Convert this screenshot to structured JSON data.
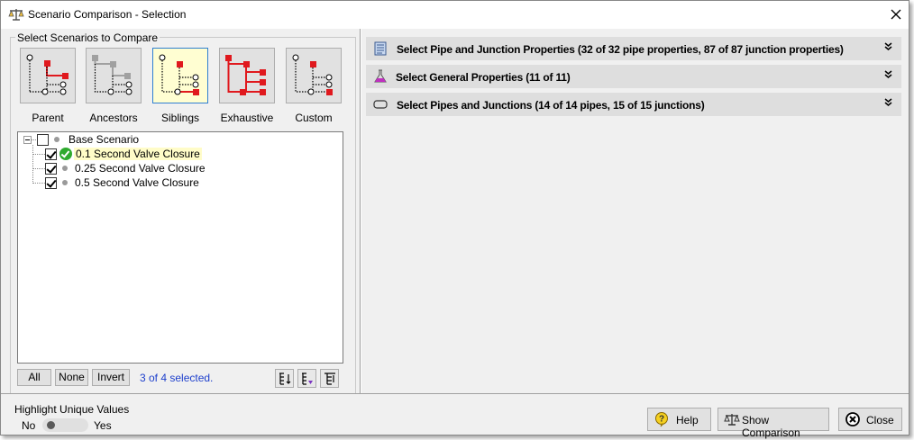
{
  "window": {
    "title": "Scenario Comparison - Selection"
  },
  "left_pane": {
    "group_label": "Select Scenarios to Compare",
    "scenario_buttons": [
      {
        "label": "Parent",
        "selected": false
      },
      {
        "label": "Ancestors",
        "selected": false
      },
      {
        "label": "Siblings",
        "selected": true
      },
      {
        "label": "Exhaustive",
        "selected": false
      },
      {
        "label": "Custom",
        "selected": false
      }
    ],
    "tree": [
      {
        "label": "Base Scenario",
        "checked": false,
        "level": 0,
        "marker": "gray-dot"
      },
      {
        "label": "0.1 Second Valve Closure",
        "checked": true,
        "level": 1,
        "marker": "green-check",
        "highlighted": true
      },
      {
        "label": "0.25 Second Valve Closure",
        "checked": true,
        "level": 1,
        "marker": "gray-dot"
      },
      {
        "label": "0.5 Second Valve Closure",
        "checked": true,
        "level": 1,
        "marker": "gray-dot"
      }
    ],
    "buttons": {
      "all": "All",
      "none": "None",
      "invert": "Invert"
    },
    "selected_count": "3 of 4 selected."
  },
  "right_pane": {
    "sections": [
      {
        "label": "Select Pipe and Junction Properties (32 of 32  pipe properties, 87 of 87 junction properties)",
        "icon": "properties-sheet-icon"
      },
      {
        "label": "Select General Properties (11 of 11)",
        "icon": "flask-icon"
      },
      {
        "label": "Select Pipes and Junctions (14 of 14  pipes, 15 of 15 junctions)",
        "icon": "pipe-icon"
      }
    ],
    "chevron": "»"
  },
  "bottom": {
    "highlight_label": "Highlight Unique Values",
    "toggle_off_label": "No",
    "toggle_on_label": "Yes",
    "toggle_value": false,
    "help_label": "Help",
    "show_comparison_label": "Show Comparison",
    "close_label": "Close"
  },
  "colors": {
    "accent_red": "#e0191e",
    "selected_fill": "#fffed2",
    "selected_border": "#2f7fd1",
    "link_blue": "#1d3fcc",
    "check_green": "#2eaa2e",
    "flask_magenta": "#c030c0"
  }
}
